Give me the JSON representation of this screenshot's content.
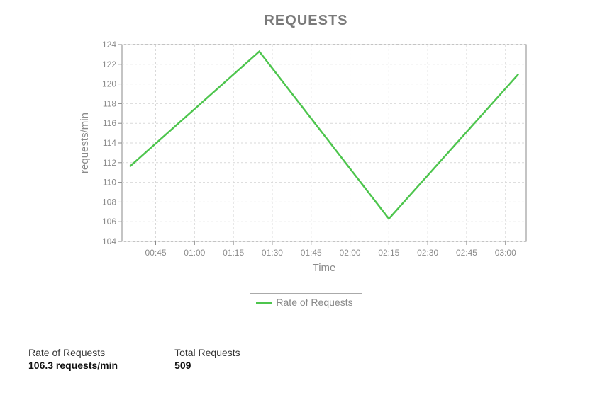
{
  "chart_data": {
    "type": "line",
    "title": "REQUESTS",
    "xlabel": "Time",
    "ylabel": "requests/min",
    "ylim": [
      104,
      124
    ],
    "yticks": [
      104,
      106,
      108,
      110,
      112,
      114,
      116,
      118,
      120,
      122,
      124
    ],
    "xticks": [
      "00:45",
      "01:00",
      "01:15",
      "01:30",
      "01:45",
      "02:00",
      "02:15",
      "02:30",
      "02:45",
      "03:00"
    ],
    "x_range": [
      "00:32",
      "03:08"
    ],
    "series": [
      {
        "name": "Rate of Requests",
        "color": "#4dc54d",
        "points": [
          {
            "x": "00:35",
            "y": 111.6
          },
          {
            "x": "01:25",
            "y": 123.3
          },
          {
            "x": "02:15",
            "y": 106.3
          },
          {
            "x": "03:05",
            "y": 121.0
          }
        ]
      }
    ]
  },
  "legend": {
    "label": "Rate of Requests"
  },
  "stats": {
    "rate": {
      "label": "Rate of Requests",
      "value": "106.3 requests/min"
    },
    "total": {
      "label": "Total Requests",
      "value": "509"
    }
  }
}
